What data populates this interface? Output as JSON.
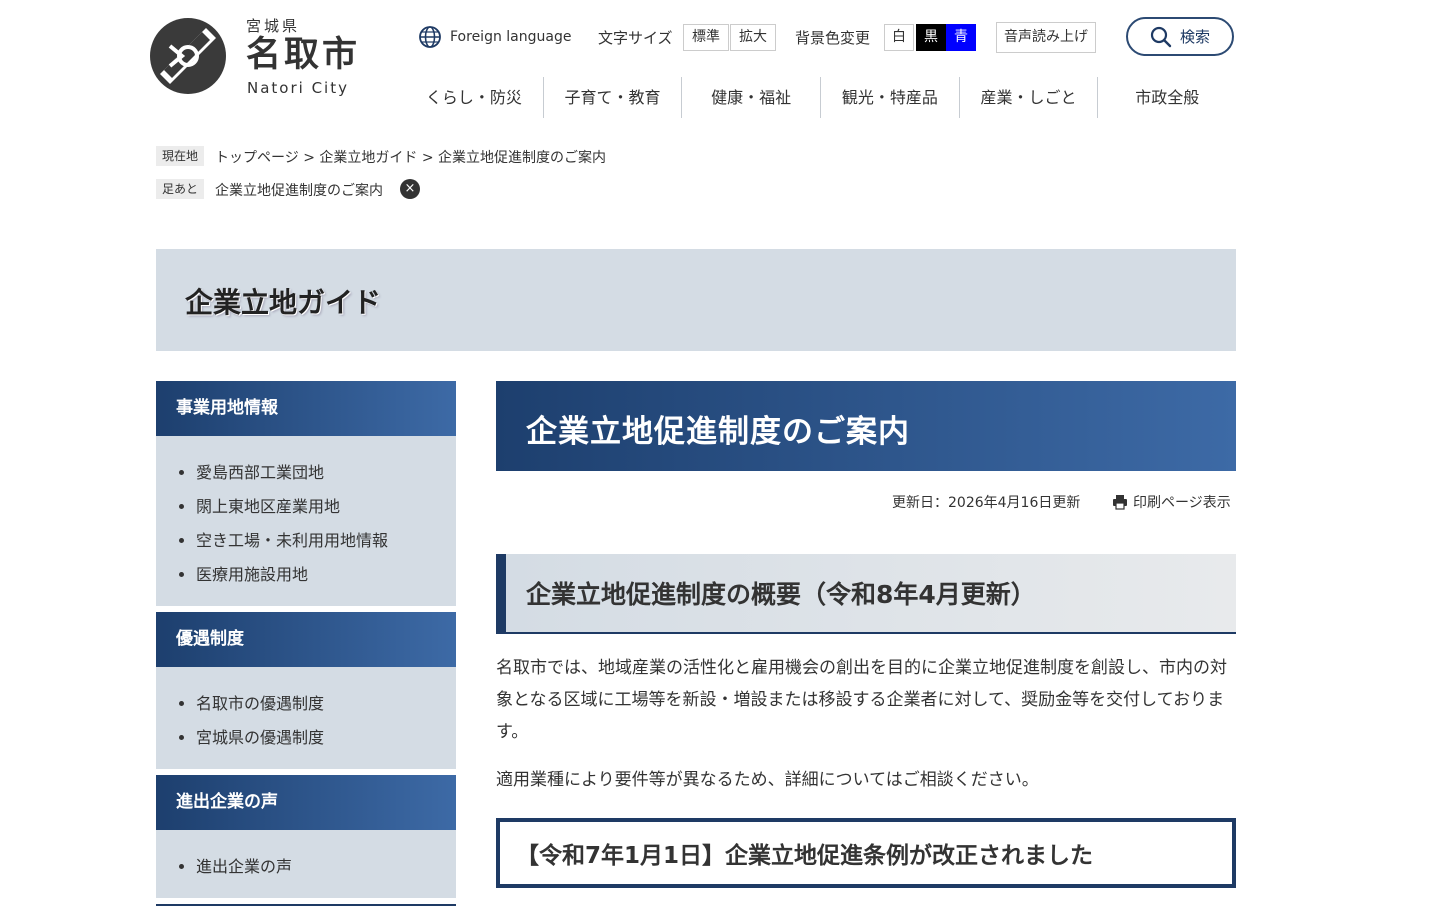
{
  "header": {
    "prefecture": "宮城県",
    "city_name": "名取市",
    "city_en": "Natori City",
    "foreign_language": "Foreign language",
    "font_size_label": "文字サイズ",
    "font_size_options": [
      "標準",
      "拡大"
    ],
    "bg_color_label": "背景色変更",
    "bg_color_options": [
      "白",
      "黒",
      "青"
    ],
    "read_aloud": "音声読み上げ",
    "search": "検索"
  },
  "global_nav": [
    "くらし・防災",
    "子育て・教育",
    "健康・福祉",
    "観光・特産品",
    "産業・しごと",
    "市政全般"
  ],
  "breadcrumb": {
    "current_label": "現在地",
    "items": [
      "トップページ",
      "企業立地ガイド",
      "企業立地促進制度のご案内"
    ],
    "sep": ">",
    "ashiato_label": "足あと",
    "ashiato_item": "企業立地促進制度のご案内",
    "close": "×"
  },
  "banner_title": "企業立地ガイド",
  "sidebar": [
    {
      "title": "事業用地情報",
      "items": [
        "愛島西部工業団地",
        "閖上東地区産業用地",
        "空き工場・未利用用地情報",
        "医療用施設用地"
      ]
    },
    {
      "title": "優遇制度",
      "items": [
        "名取市の優遇制度",
        "宮城県の優遇制度"
      ]
    },
    {
      "title": "進出企業の声",
      "items": [
        "進出企業の声"
      ]
    }
  ],
  "main": {
    "title": "企業立地促進制度のご案内",
    "updated": "更新日：2026年4月16日更新",
    "print": "印刷ページ表示",
    "section_title": "企業立地促進制度の概要（令和8年4月更新）",
    "paragraphs": [
      "名取市では、地域産業の活性化と雇用機会の創出を目的に企業立地促進制度を創設し、市内の対象となる区域に工場等を新設・増設または移設する企業者に対して、奨励金等を交付しております。",
      "適用業種により要件等が異なるため、詳細についてはご相談ください。"
    ],
    "subsection_title": "【令和7年1月1日】企業立地促進条例が改正されました"
  },
  "colors": {
    "navy": "#1e3a64",
    "banner_bg": "#d4dce4",
    "black_option": "#000000",
    "blue_option": "#0000ff"
  }
}
